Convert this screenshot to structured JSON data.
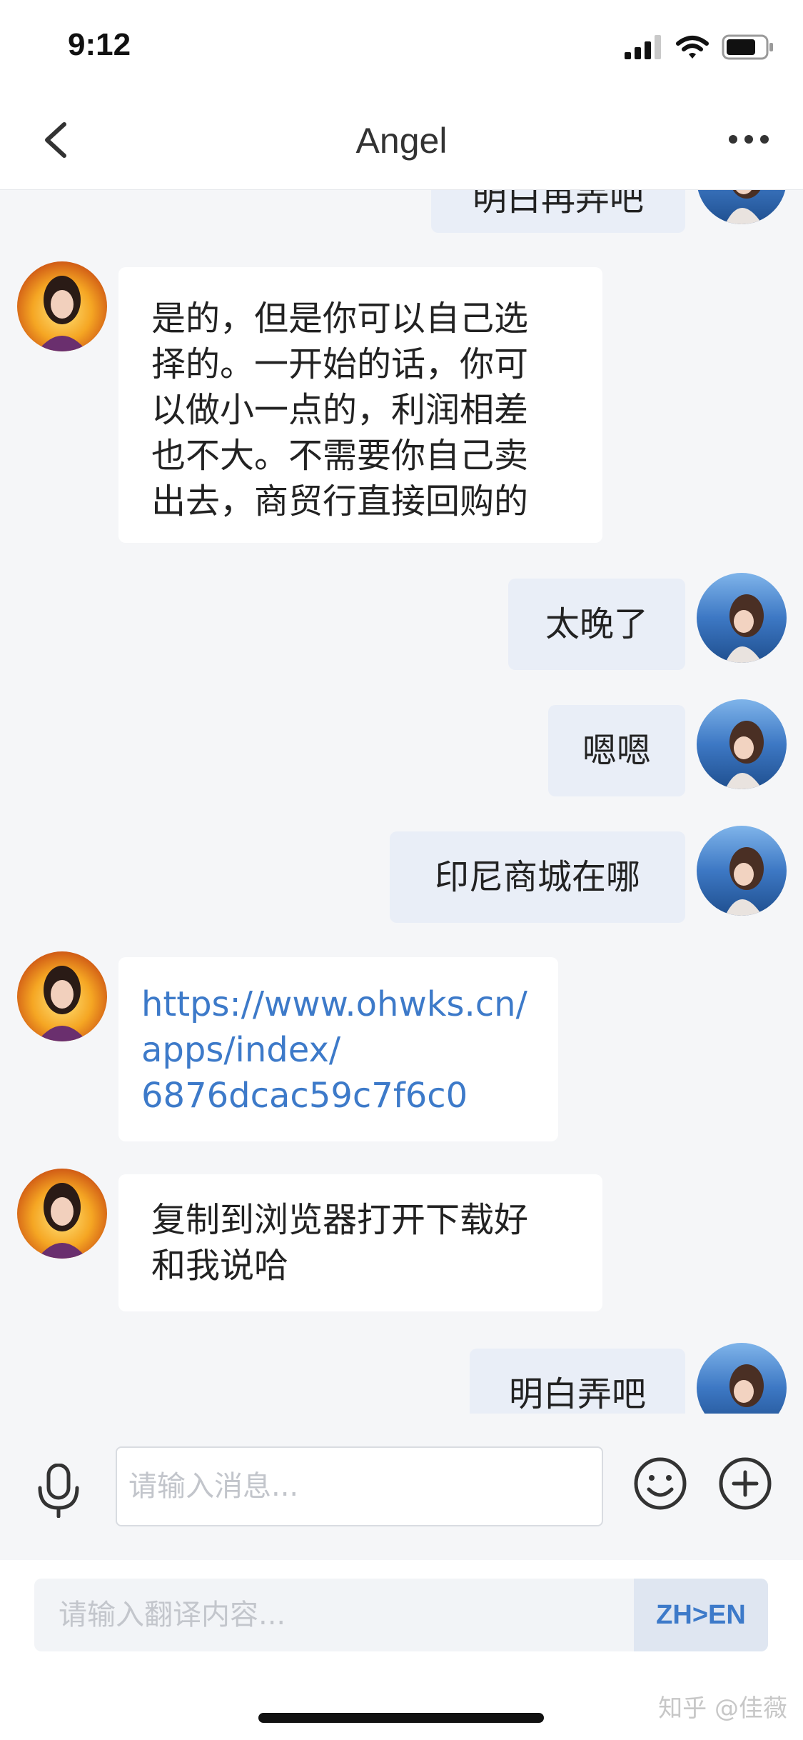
{
  "status_bar": {
    "time": "9:12"
  },
  "nav": {
    "title": "Angel"
  },
  "messages": [
    {
      "side": "sent",
      "text": "明白再弄吧"
    },
    {
      "side": "received",
      "lines": [
        "是的，但是你可以自己选",
        "择的。一开始的话，你可",
        "以做小一点的，利润相差",
        "也不大。不需要你自己卖",
        "出去，商贸行直接回购的"
      ]
    },
    {
      "side": "sent",
      "text": "太晚了"
    },
    {
      "side": "sent",
      "text": "嗯嗯"
    },
    {
      "side": "sent",
      "text": "印尼商城在哪"
    },
    {
      "side": "received",
      "lines": [
        "https://www.ohwks.cn/",
        "apps/index/",
        "6876dcac59c7f6c0"
      ]
    },
    {
      "side": "received",
      "lines": [
        "复制到浏览器打开下载好",
        "和我说哈"
      ]
    },
    {
      "side": "sent",
      "text": "明白弄吧"
    }
  ],
  "input": {
    "placeholder": "请输入消息..."
  },
  "translate": {
    "placeholder": "请输入翻译内容...",
    "lang_toggle": "ZH>EN"
  },
  "watermark": "知乎 @佳薇",
  "colors": {
    "link": "#3d7ac9",
    "sent_bubble": "#e9eef7",
    "background": "#f5f6f8"
  }
}
